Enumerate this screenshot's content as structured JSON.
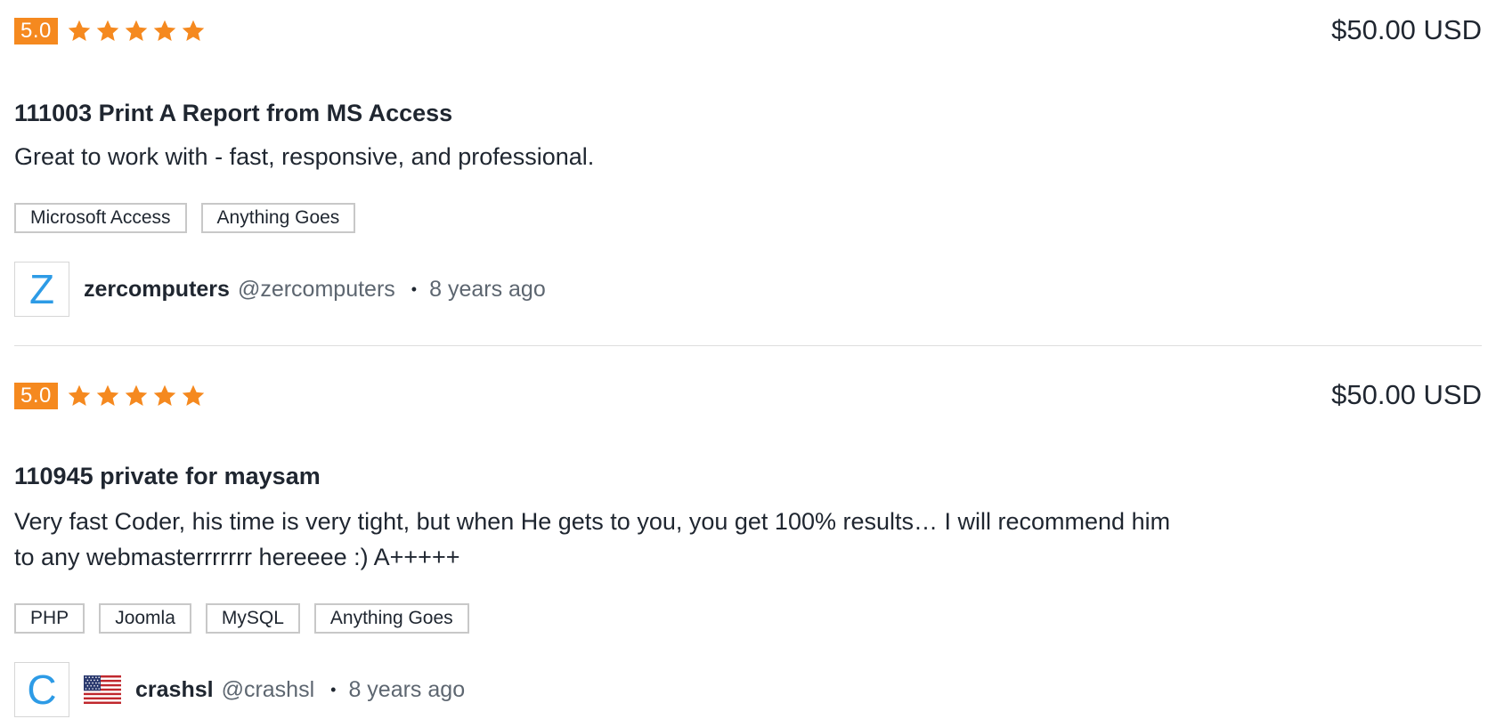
{
  "reviews": [
    {
      "rating": "5.0",
      "stars": 5,
      "price": "$50.00 USD",
      "project_title": "111003 Print A Report from MS Access",
      "comment": "Great to work with - fast, responsive, and professional.",
      "tags": [
        "Microsoft Access",
        "Anything Goes"
      ],
      "author": {
        "avatar_letter": "Z",
        "name": "zercomputers",
        "handle": "@zercomputers",
        "flag": null
      },
      "separator": "•",
      "time_ago": "8 years ago"
    },
    {
      "rating": "5.0",
      "stars": 5,
      "price": "$50.00 USD",
      "project_title": "110945 private for maysam",
      "comment": "Very fast Coder, his time is very tight, but when He gets to you, you get 100% results… I will recommend him to any webmasterrrrrrr hereeee :) A+++++",
      "tags": [
        "PHP",
        "Joomla",
        "MySQL",
        "Anything Goes"
      ],
      "author": {
        "avatar_letter": "C",
        "name": "crashsl",
        "handle": "@crashsl",
        "flag": "us-flag-icon"
      },
      "separator": "•",
      "time_ago": "8 years ago"
    }
  ],
  "colors": {
    "accent": "#f5891f",
    "avatar_letter": "#2d9be6",
    "text": "#1f2630",
    "muted": "#5d6670"
  }
}
